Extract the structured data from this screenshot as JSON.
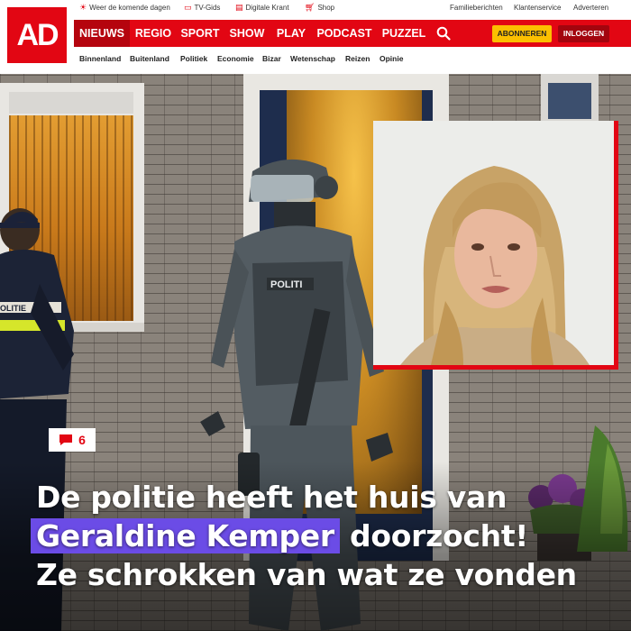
{
  "site": {
    "logo_text": "AD",
    "brand_color": "#e20613"
  },
  "topbar": {
    "left_items": [
      {
        "icon": "weather-icon",
        "label": "Weer de komende dagen"
      },
      {
        "icon": "tv-icon",
        "label": "TV-Gids"
      },
      {
        "icon": "newspaper-icon",
        "label": "Digitale Krant"
      },
      {
        "icon": "cart-icon",
        "label": "Shop"
      }
    ],
    "right_items": [
      "Familieberichten",
      "Klantenservice",
      "Adverteren"
    ]
  },
  "nav": {
    "items": [
      "NIEUWS",
      "REGIO",
      "SPORT",
      "SHOW",
      "PLAY",
      "PODCAST",
      "PUZZEL"
    ],
    "active": "NIEUWS",
    "search_icon": "search-icon",
    "subscribe_label": "ABONNEREN",
    "login_label": "INLOGGEN",
    "subscribe_color": "#fcbf00",
    "login_color": "#a3050e"
  },
  "subnav": {
    "items": [
      "Binnenland",
      "Buitenland",
      "Politiek",
      "Economie",
      "Bizar",
      "Wetenschap",
      "Reizen",
      "Opinie"
    ]
  },
  "article": {
    "comment_icon": "comment-icon",
    "comment_count": "6",
    "headline_line1": "De politie heeft het huis van",
    "headline_highlight": "Geraldine Kemper",
    "headline_line2_rest": " doorzocht!",
    "headline_line3": "Ze schrokken van wat ze vonden",
    "highlight_color": "#6b4ce6",
    "vest_text": "POLITIE",
    "officer_vest_text": "POLITI"
  }
}
